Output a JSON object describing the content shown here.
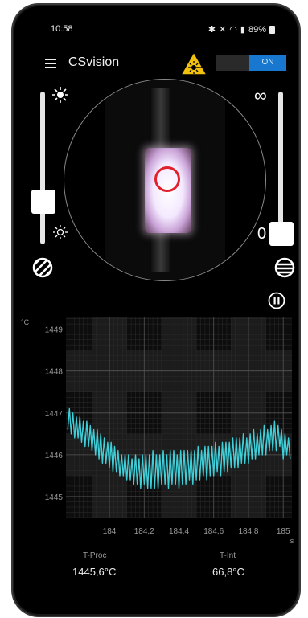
{
  "status": {
    "time": "10:58",
    "battery": "89%"
  },
  "appbar": {
    "title": "CSvision",
    "toggle_label": "ON"
  },
  "controls": {
    "infinity_symbol": "∞",
    "zero_label": "0"
  },
  "chart_data": {
    "type": "line",
    "y_unit": "°C",
    "x_unit": "s",
    "xlim": [
      183.75,
      185.05
    ],
    "ylim": [
      1444.5,
      1449.3
    ],
    "x_ticks": [
      "184",
      "184,2",
      "184,4",
      "184,6",
      "184,8",
      "185"
    ],
    "y_ticks": [
      "1449",
      "1448",
      "1447",
      "1446",
      "1445"
    ],
    "grid": true,
    "series": [
      {
        "color": "#3ecfd8",
        "x": [
          183.76,
          183.77,
          183.78,
          183.79,
          183.8,
          183.81,
          183.82,
          183.83,
          183.84,
          183.85,
          183.86,
          183.87,
          183.88,
          183.89,
          183.9,
          183.91,
          183.92,
          183.93,
          183.94,
          183.95,
          183.96,
          183.97,
          183.98,
          183.99,
          184.0,
          184.01,
          184.02,
          184.03,
          184.04,
          184.05,
          184.06,
          184.07,
          184.08,
          184.09,
          184.1,
          184.11,
          184.12,
          184.13,
          184.14,
          184.15,
          184.16,
          184.17,
          184.18,
          184.19,
          184.2,
          184.21,
          184.22,
          184.23,
          184.24,
          184.25,
          184.26,
          184.27,
          184.28,
          184.29,
          184.3,
          184.31,
          184.32,
          184.33,
          184.34,
          184.35,
          184.36,
          184.37,
          184.38,
          184.39,
          184.4,
          184.41,
          184.42,
          184.43,
          184.44,
          184.45,
          184.46,
          184.47,
          184.48,
          184.49,
          184.5,
          184.51,
          184.52,
          184.53,
          184.54,
          184.55,
          184.56,
          184.57,
          184.58,
          184.59,
          184.6,
          184.61,
          184.62,
          184.63,
          184.64,
          184.65,
          184.66,
          184.67,
          184.68,
          184.69,
          184.7,
          184.71,
          184.72,
          184.73,
          184.74,
          184.75,
          184.76,
          184.77,
          184.78,
          184.79,
          184.8,
          184.81,
          184.82,
          184.83,
          184.84,
          184.85,
          184.86,
          184.87,
          184.88,
          184.89,
          184.9,
          184.91,
          184.92,
          184.93,
          184.94,
          184.95,
          184.96,
          184.97,
          184.98,
          184.99,
          185.0,
          185.01,
          185.02,
          185.03,
          185.04
        ],
        "y": [
          1446.6,
          1447.1,
          1446.5,
          1447.0,
          1446.4,
          1446.9,
          1446.4,
          1446.9,
          1446.3,
          1446.8,
          1446.2,
          1446.8,
          1446.2,
          1446.7,
          1446.1,
          1446.6,
          1446.0,
          1446.6,
          1445.9,
          1446.5,
          1445.8,
          1446.4,
          1445.8,
          1446.3,
          1445.7,
          1446.3,
          1445.6,
          1446.2,
          1445.6,
          1446.1,
          1445.5,
          1446.0,
          1445.5,
          1446.0,
          1445.4,
          1446.0,
          1445.4,
          1445.9,
          1445.3,
          1446.0,
          1445.3,
          1445.9,
          1445.2,
          1446.0,
          1445.3,
          1446.0,
          1445.2,
          1446.0,
          1445.2,
          1446.1,
          1445.2,
          1446.0,
          1445.2,
          1446.0,
          1445.3,
          1446.1,
          1445.3,
          1446.0,
          1445.2,
          1446.1,
          1445.3,
          1446.1,
          1445.3,
          1446.0,
          1445.2,
          1446.1,
          1445.3,
          1446.1,
          1445.3,
          1446.1,
          1445.4,
          1446.1,
          1445.3,
          1446.1,
          1445.4,
          1446.2,
          1445.4,
          1446.1,
          1445.5,
          1446.2,
          1445.4,
          1446.2,
          1445.5,
          1446.2,
          1445.5,
          1446.3,
          1445.6,
          1446.2,
          1445.5,
          1446.3,
          1445.6,
          1446.3,
          1445.6,
          1446.3,
          1445.7,
          1446.4,
          1445.7,
          1446.4,
          1445.7,
          1446.4,
          1445.8,
          1446.5,
          1445.8,
          1446.4,
          1445.8,
          1446.5,
          1445.9,
          1446.6,
          1445.9,
          1446.5,
          1446.0,
          1446.6,
          1446.0,
          1446.7,
          1446.0,
          1446.6,
          1446.1,
          1446.7,
          1446.1,
          1446.8,
          1446.1,
          1446.7,
          1446.2,
          1446.6,
          1445.9,
          1446.5,
          1446.0,
          1446.4,
          1445.9
        ]
      }
    ]
  },
  "readouts": [
    {
      "label": "T-Proc",
      "value": "1445,6°C",
      "color": "#4fc3cf"
    },
    {
      "label": "T-Int",
      "value": "66,8°C",
      "color": "#d9826a"
    }
  ]
}
